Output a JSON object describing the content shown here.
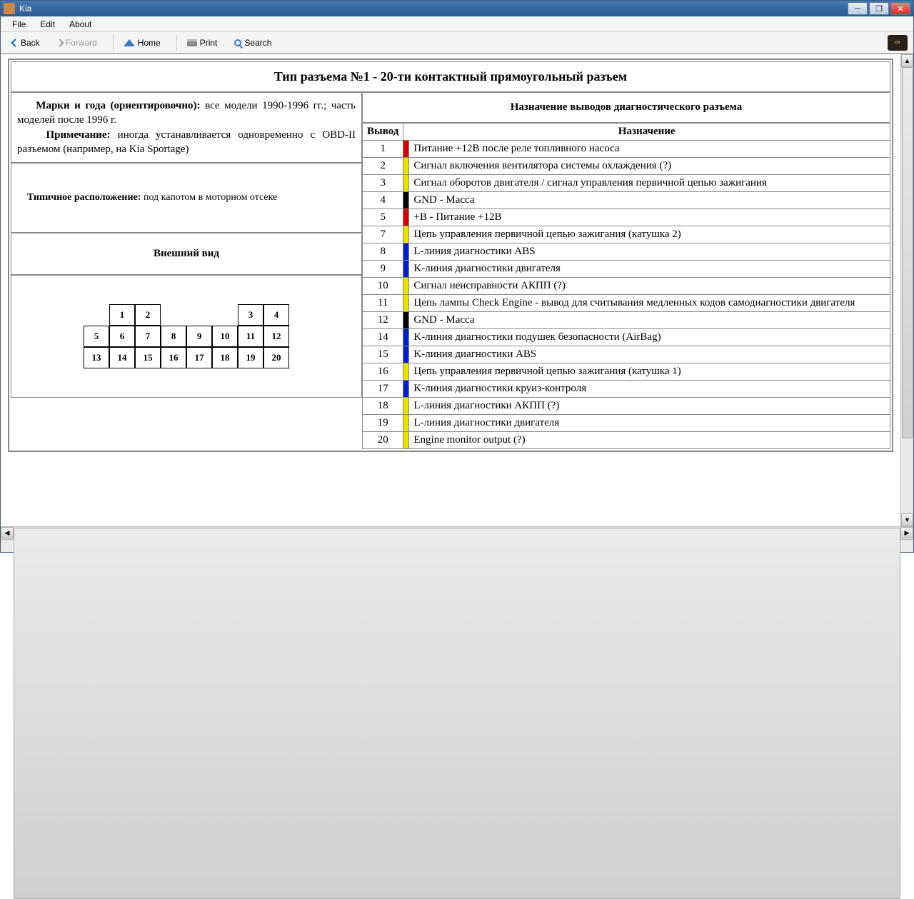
{
  "window": {
    "title": "Kia"
  },
  "menu": {
    "file": "File",
    "edit": "Edit",
    "about": "About"
  },
  "toolbar": {
    "back": "Back",
    "forward": "Forward",
    "home": "Home",
    "print": "Print",
    "search": "Search"
  },
  "page": {
    "title": "Тип разъема №1 - 20-ти контактный прямоугольный разъем",
    "brands_label": "Марки и года (ориентировочно):",
    "brands_text": " все модели 1990-1996 гг.; часть моделей после 1996 г.",
    "note_label": "Примечание:",
    "note_text": " иногда устанавливается одновременно с OBD-II разъемом (например, на Kia Sportage)",
    "location_label": "Типичное расположение:",
    "location_text": " под капотом в моторном отсеке",
    "appearance_title": "Внешний вид",
    "pin_table_title": "Назначение выводов диагностического разъема",
    "col_pin": "Вывод",
    "col_desc": "Назначение"
  },
  "connector_pins": [
    "1",
    "2",
    "3",
    "4",
    "5",
    "6",
    "7",
    "8",
    "9",
    "10",
    "11",
    "12",
    "13",
    "14",
    "15",
    "16",
    "17",
    "18",
    "19",
    "20"
  ],
  "pins": [
    {
      "n": "1",
      "color": "#d00000",
      "desc": "Питание +12В после реле топливного насоса"
    },
    {
      "n": "2",
      "color": "#e8e000",
      "desc": "Сигнал включения вентилятора системы охлаждения (?)"
    },
    {
      "n": "3",
      "color": "#e8e000",
      "desc": "Сигнал оборотов двигателя / сигнал управления первичной цепью зажигания"
    },
    {
      "n": "4",
      "color": "#000000",
      "desc": "GND - Масса"
    },
    {
      "n": "5",
      "color": "#d00000",
      "desc": "+B - Питание +12В"
    },
    {
      "n": "7",
      "color": "#e8e000",
      "desc": "Цепь управления первичной цепью зажигания (катушка 2)"
    },
    {
      "n": "8",
      "color": "#0020c0",
      "desc": "L-линия диагностики ABS"
    },
    {
      "n": "9",
      "color": "#0020c0",
      "desc": "K-линия диагностики двигателя"
    },
    {
      "n": "10",
      "color": "#e8e000",
      "desc": "Сигнал неисправности АКПП (?)"
    },
    {
      "n": "11",
      "color": "#e8e000",
      "desc": "Цепь лампы Check Engine - вывод для считывания медленных кодов самодиагностики двигателя"
    },
    {
      "n": "12",
      "color": "#000000",
      "desc": "GND - Масса"
    },
    {
      "n": "14",
      "color": "#0020c0",
      "desc": "K-линия диагностики подушек безопасности (AirBag)"
    },
    {
      "n": "15",
      "color": "#0020c0",
      "desc": "K-линия диагностики ABS"
    },
    {
      "n": "16",
      "color": "#e8e000",
      "desc": "Цепь управления первичной цепью зажигания (катушка 1)"
    },
    {
      "n": "17",
      "color": "#0020c0",
      "desc": "K-линия диагностики круиз-контроля"
    },
    {
      "n": "18",
      "color": "#e8e000",
      "desc": "L-линия диагностики АКПП (?)"
    },
    {
      "n": "19",
      "color": "#e8e000",
      "desc": "L-линия диагностики двигателя"
    },
    {
      "n": "20",
      "color": "#e8e000",
      "desc": "Engine monitor output (?)"
    }
  ]
}
